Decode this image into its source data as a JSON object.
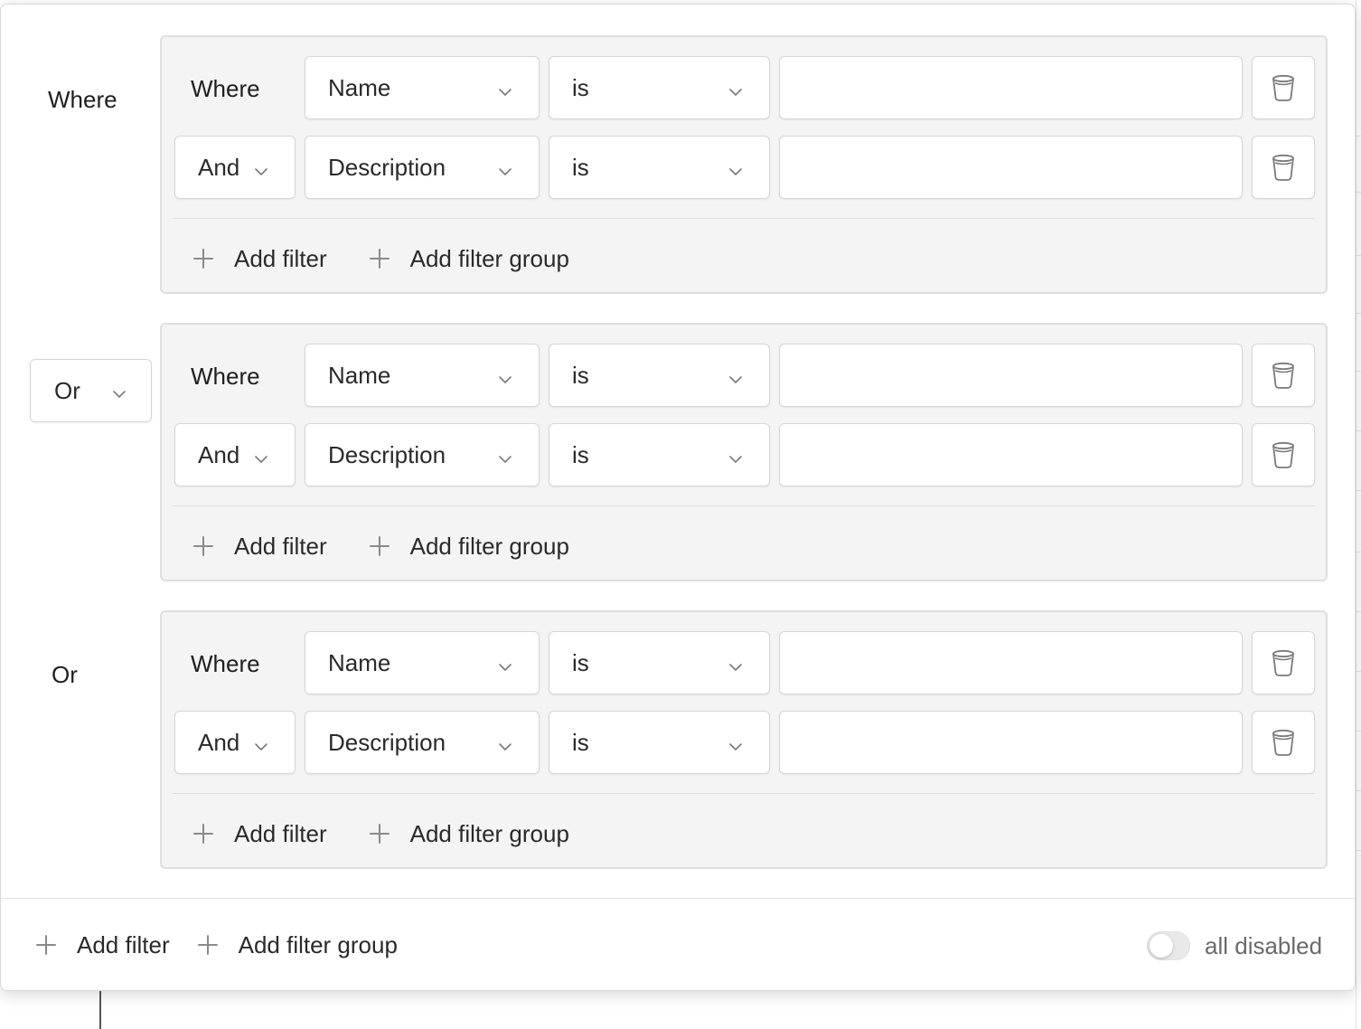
{
  "filter_groups": [
    {
      "combinator": "Where",
      "combinator_is_select": false,
      "rows": [
        {
          "lead": "Where",
          "field": "Name",
          "operator": "is",
          "value": ""
        },
        {
          "lead": "And",
          "field": "Description",
          "operator": "is",
          "value": ""
        }
      ],
      "add_filter_label": "Add filter",
      "add_group_label": "Add filter group"
    },
    {
      "combinator": "Or",
      "combinator_is_select": true,
      "rows": [
        {
          "lead": "Where",
          "field": "Name",
          "operator": "is",
          "value": ""
        },
        {
          "lead": "And",
          "field": "Description",
          "operator": "is",
          "value": ""
        }
      ],
      "add_filter_label": "Add filter",
      "add_group_label": "Add filter group"
    },
    {
      "combinator": "Or",
      "combinator_is_select": false,
      "rows": [
        {
          "lead": "Where",
          "field": "Name",
          "operator": "is",
          "value": ""
        },
        {
          "lead": "And",
          "field": "Description",
          "operator": "is",
          "value": ""
        }
      ],
      "add_filter_label": "Add filter",
      "add_group_label": "Add filter group"
    }
  ],
  "footer": {
    "add_filter_label": "Add filter",
    "add_group_label": "Add filter group",
    "toggle_label": "all disabled",
    "toggle_on": false
  },
  "icons": {
    "chevron": "chevron-down-icon",
    "trash": "trash-icon",
    "plus": "plus-icon"
  },
  "colors": {
    "group_background": "#f4f4f4",
    "border": "#d6d6d6",
    "text": "#2a2a2a",
    "muted_text": "#6a6a6a"
  }
}
